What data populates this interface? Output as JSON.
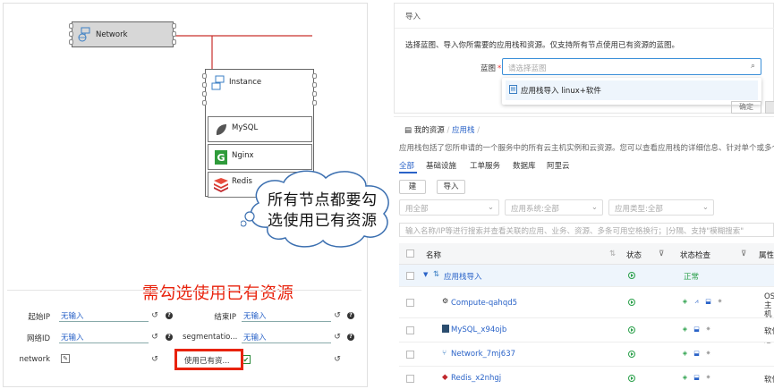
{
  "topology": {
    "network_label": "Network",
    "instance_label": "Instance",
    "apps": [
      "MySQL",
      "Nginx",
      "Redis"
    ]
  },
  "callout": {
    "cloud_line1": "所有节点都要勾",
    "cloud_line2": "选使用已有资源",
    "note": "需勾选使用已有资源"
  },
  "form": {
    "start_ip_label": "起始IP",
    "start_ip_value": "无输入",
    "end_ip_label": "结束IP",
    "end_ip_value": "无输入",
    "network_id_label": "网络ID",
    "network_id_value": "无输入",
    "segmentation_label": "segmentatio...",
    "segmentation_value": "无输入",
    "network_label": "network",
    "use_existing_label": "使用已有资..."
  },
  "import_dialog": {
    "title": "导入",
    "description": "选择蓝图、导入你所需要的应用栈和资源。仅支持所有节点使用已有资源的蓝图。",
    "blueprint_label": "蓝图",
    "required_mark": "*",
    "blueprint_placeholder": "请选择蓝图",
    "option": "应用栈导入 linux+软件",
    "btn_partial": "确定"
  },
  "resources": {
    "breadcrumb_root": "我的资源",
    "breadcrumb_current": "应用栈",
    "breadcrumb_sep": "/",
    "description": "应用栈包括了您所申请的一个服务中的所有云主机实例和云资源。您可以查看应用栈的详细信息、针对单个或多个应用",
    "tabs": [
      "全部",
      "基础设施",
      "工单服务",
      "数据库",
      "阿里云"
    ],
    "buttons": {
      "create": "建",
      "import": "导入"
    },
    "filters": [
      "用全部",
      "应用系统:全部",
      "应用类型:全部"
    ],
    "search_placeholder": "输入名称/IP等进行搜索并查看关联的应用、业务、资源、多条可用空格换行；|分隔、支持\"模糊搜索\"",
    "columns": {
      "name": "名称",
      "status": "状态",
      "status_check": "状态检查",
      "attr": "属性"
    },
    "rows": [
      {
        "name": "应用栈导入",
        "check": "正常",
        "attr": "",
        "type": "group"
      },
      {
        "name": "Compute-qahqd5",
        "check": "",
        "attr": "OS主机 IP地址",
        "type": "compute"
      },
      {
        "name": "MySQL_x94ojb",
        "check": "",
        "attr": "软件",
        "type": "mysql"
      },
      {
        "name": "Network_7mj637",
        "check": "",
        "attr": "",
        "type": "network"
      },
      {
        "name": "Redis_x2nhgj",
        "check": "",
        "attr": "软件",
        "type": "redis"
      }
    ]
  }
}
